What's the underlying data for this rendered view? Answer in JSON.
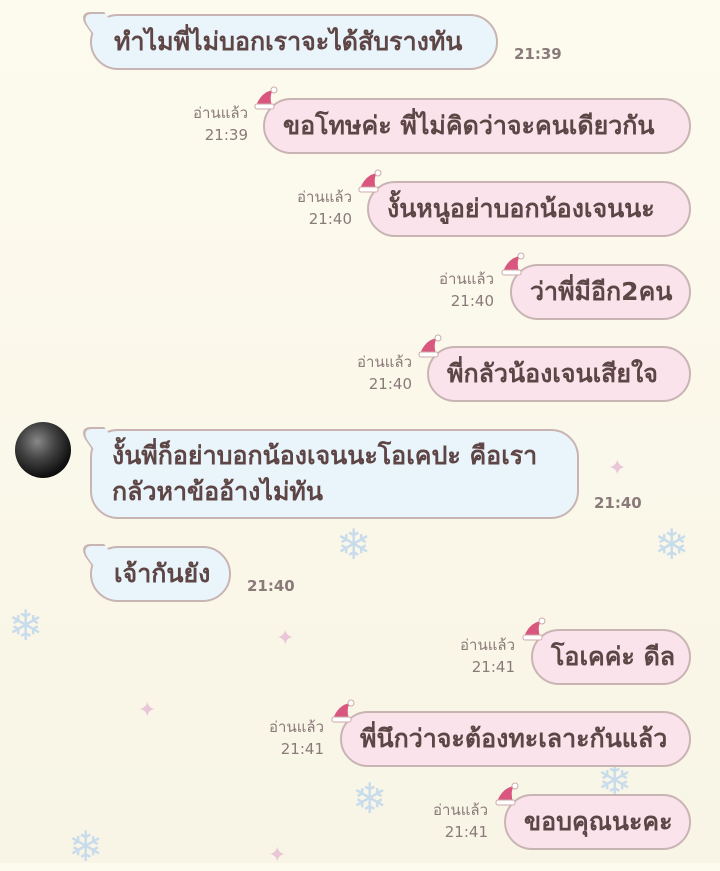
{
  "messages": [
    {
      "side": "in",
      "lines": [
        "ทำไมพี่ไม่บอกเราจะได้สับรางทัน"
      ],
      "time": "21:39"
    },
    {
      "side": "out",
      "lines": [
        "ขอโทษค่ะ พี่ไม่คิดว่าจะคนเดียวกัน"
      ],
      "read": "อ่านแล้ว",
      "time": "21:39"
    },
    {
      "side": "out",
      "lines": [
        "งั้นหนูอย่าบอกน้องเจนนะ"
      ],
      "read": "อ่านแล้ว",
      "time": "21:40"
    },
    {
      "side": "out",
      "lines": [
        "ว่าพี่มีอีก2คน"
      ],
      "read": "อ่านแล้ว",
      "time": "21:40"
    },
    {
      "side": "out",
      "lines": [
        "พี่กลัวน้องเจนเสียใจ"
      ],
      "read": "อ่านแล้ว",
      "time": "21:40"
    },
    {
      "side": "in",
      "lines": [
        "งั้นพี่ก็อย่าบอกน้องเจนนะโอเคปะ คือเรา",
        "กลัวหาข้ออ้างไม่ทัน"
      ],
      "time": "21:40"
    },
    {
      "side": "in",
      "lines": [
        "เจ้ากันยัง"
      ],
      "time": "21:40"
    },
    {
      "side": "out",
      "lines": [
        "โอเคค่ะ ดีล"
      ],
      "read": "อ่านแล้ว",
      "time": "21:41"
    },
    {
      "side": "out",
      "lines": [
        "พี่นึกว่าจะต้องทะเลาะกันแล้ว"
      ],
      "read": "อ่านแล้ว",
      "time": "21:41"
    },
    {
      "side": "out",
      "lines": [
        "ขอบคุณนะคะ"
      ],
      "read": "อ่านแล้ว",
      "time": "21:41"
    }
  ],
  "colors": {
    "incoming_bubble": "#eaf5fb",
    "outgoing_bubble": "#fbe3ec",
    "text": "#5e4646",
    "border": "#c9b4b4"
  },
  "icons": {
    "sender_avatar": "avatar",
    "bubble_decoration": "santa-hat-icon",
    "background_pattern": "snowflake-icon"
  }
}
